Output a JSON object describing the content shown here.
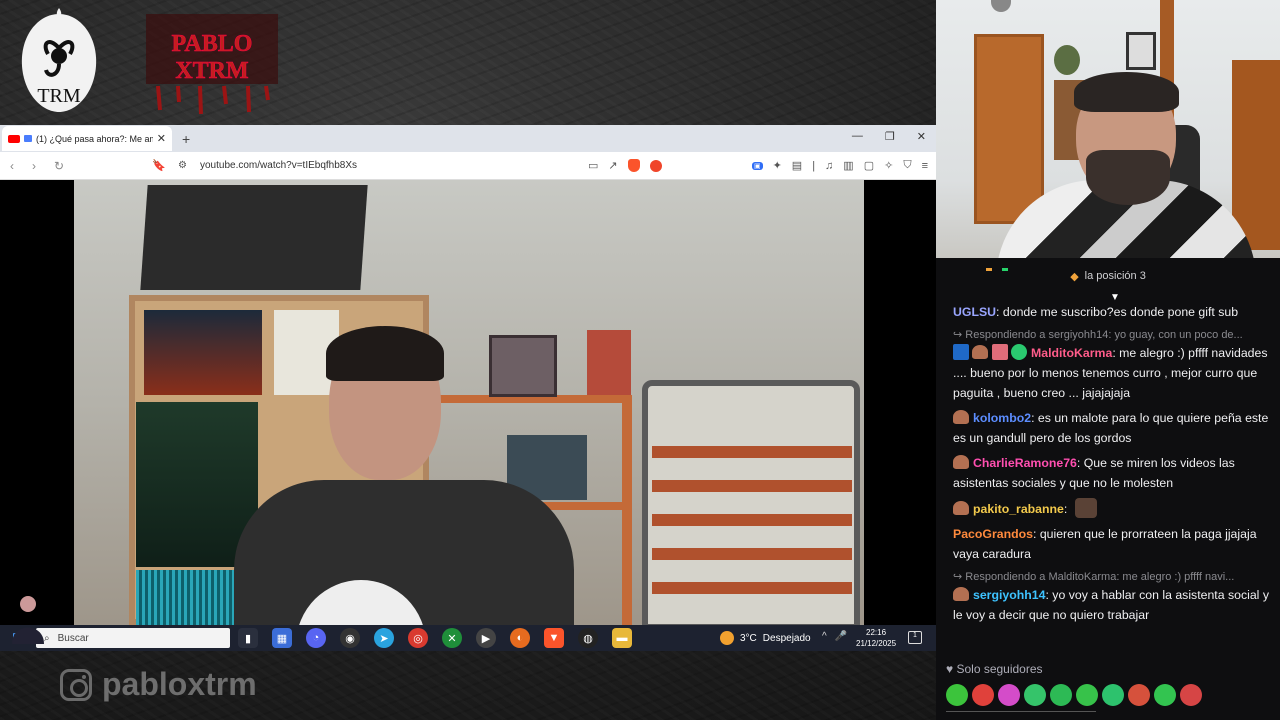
{
  "overlay": {
    "logo_left": "TRM",
    "logo_right": "PABLO XTRM",
    "instagram_handle": "pabloxtrm"
  },
  "browser": {
    "tab_title": "(1) ¿Qué pasa ahora?: Me am",
    "address": "youtube.com/watch?v=tIEbqfhb8Xs",
    "rewards_badge": "3"
  },
  "taskbar": {
    "search_placeholder": "Buscar",
    "weather_temp": "3°C",
    "weather_text": "Despejado",
    "time": "22:16",
    "date": "21/12/2025",
    "notification_count": "1",
    "apps": [
      "task-view",
      "store",
      "discord",
      "obs",
      "telegram",
      "chrome",
      "xbox",
      "media-player",
      "firefox",
      "brave",
      "recorder",
      "explorer"
    ]
  },
  "chat": {
    "header_text": "la posición 3",
    "messages": [
      {
        "type": "msg",
        "user": "UGLSU",
        "color": "#9aa6ff",
        "text": "donde me suscribo?es donde pone gift sub"
      },
      {
        "type": "reply",
        "text": "Respondiendo a sergiyohh14: yo guay, con un poco de..."
      },
      {
        "type": "msg",
        "user": "MalditoKarma",
        "color": "#ff5c8a",
        "text": "me alegro :) pffff navidades .... bueno por lo menos tenemos curro , mejor curro que paguita , bueno creo ... jajajajaja"
      },
      {
        "type": "msg",
        "user": "kolombo2",
        "color": "#5c8dff",
        "text": "es un malote para lo que quiere peña este es un gandull pero de los gordos"
      },
      {
        "type": "msg",
        "user": "CharlieRamone76",
        "color": "#ff4fb0",
        "text": "Que se miren los videos las asistentas sociales y que no le molesten"
      },
      {
        "type": "msg",
        "user": "pakito_rabanne",
        "color": "#f2c94c",
        "text": ""
      },
      {
        "type": "msg",
        "user": "PacoGrandos",
        "color": "#ff8a3d",
        "text": "quieren que le prorrateen la paga jjajaja vaya caradura"
      },
      {
        "type": "reply",
        "text": "Respondiendo a MalditoKarma: me alegro :) pffff navi..."
      },
      {
        "type": "msg",
        "user": "sergiyohh14",
        "color": "#3ec3ff",
        "text": "yo voy a hablar con la asistenta social y le voy a decir que no quiero trabajar"
      }
    ],
    "mode_label": "Solo seguidores",
    "emote_colors": [
      "#3cc43c",
      "#e0413b",
      "#d44cc9",
      "#35c46a",
      "#2dba55",
      "#37c24a",
      "#2dc26d",
      "#d6513c",
      "#33c450",
      "#d64545"
    ]
  }
}
